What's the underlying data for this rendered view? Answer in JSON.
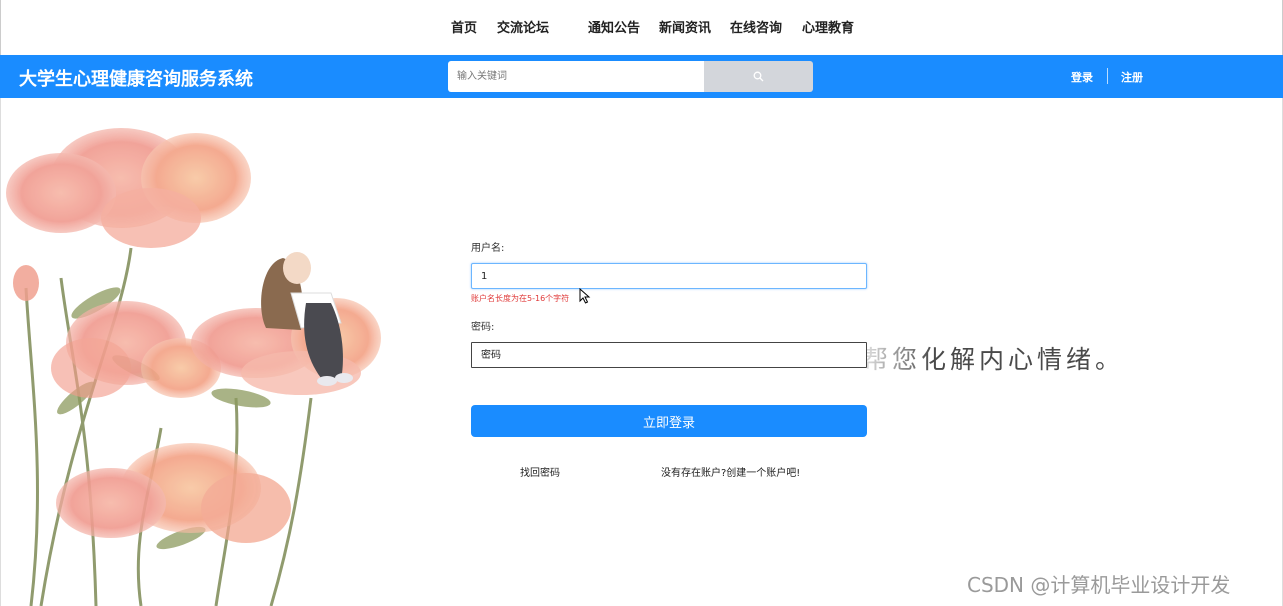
{
  "nav": {
    "items": [
      {
        "label": "首页"
      },
      {
        "label": "交流论坛"
      },
      {
        "label": "通知公告"
      },
      {
        "label": "新闻资讯"
      },
      {
        "label": "在线咨询"
      },
      {
        "label": "心理教育"
      }
    ]
  },
  "header": {
    "title": "大学生心理健康咨询服务系统",
    "search_placeholder": "输入关键词",
    "login_label": "登录",
    "register_label": "注册"
  },
  "form": {
    "username_label": "用户名:",
    "username_value": "1",
    "username_error": "账户名长度为在5-16个字符",
    "password_label": "密码:",
    "password_placeholder": "密码",
    "login_button": "立即登录",
    "forgot_password": "找回密码",
    "create_account": "没有存在账户?创建一个账户吧!"
  },
  "background": {
    "slogan": "帮您化解内心情绪。"
  },
  "watermark": "CSDN @计算机毕业设计开发",
  "colors": {
    "primary": "#1a8cff",
    "error": "#e03a3a",
    "search_button": "#d3d6db"
  }
}
